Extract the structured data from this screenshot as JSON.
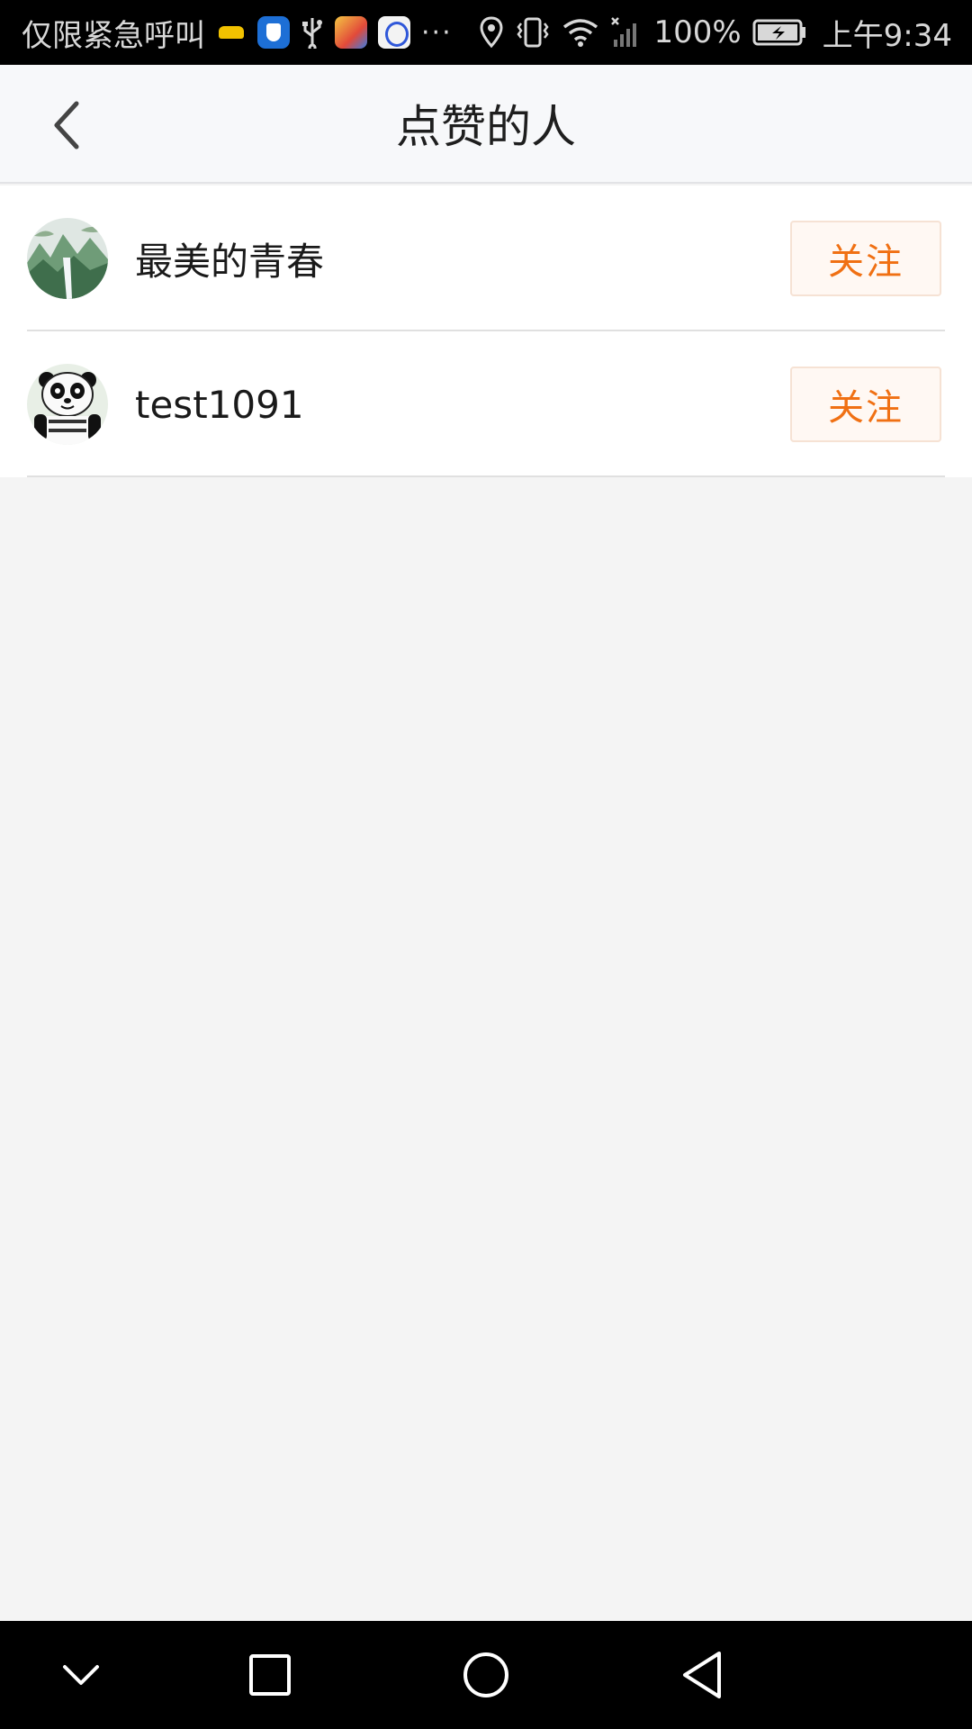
{
  "status_bar": {
    "carrier_text": "仅限紧急呼叫",
    "more": "···",
    "battery": "100%",
    "time": "上午9:34",
    "icons": [
      "taxi-app-icon",
      "shield-app-icon",
      "usb-icon",
      "map-app-icon",
      "baidu-app-icon",
      "location-icon",
      "vibrate-icon",
      "wifi-icon",
      "signal-icon",
      "battery-icon"
    ]
  },
  "header": {
    "title": "点赞的人",
    "back_icon": "chevron-left-icon"
  },
  "likers": [
    {
      "name": "最美的青春",
      "follow_label": "关注",
      "avatar": "landscape-avatar"
    },
    {
      "name": "test1091",
      "follow_label": "关注",
      "avatar": "panda-avatar"
    }
  ],
  "nav_bar": {
    "icons": [
      "collapse-down-icon",
      "recents-square-icon",
      "home-circle-icon",
      "back-triangle-icon"
    ]
  },
  "colors": {
    "accent": "#f07013",
    "follow_bg": "#fff8f3",
    "background": "#f4f4f4"
  }
}
